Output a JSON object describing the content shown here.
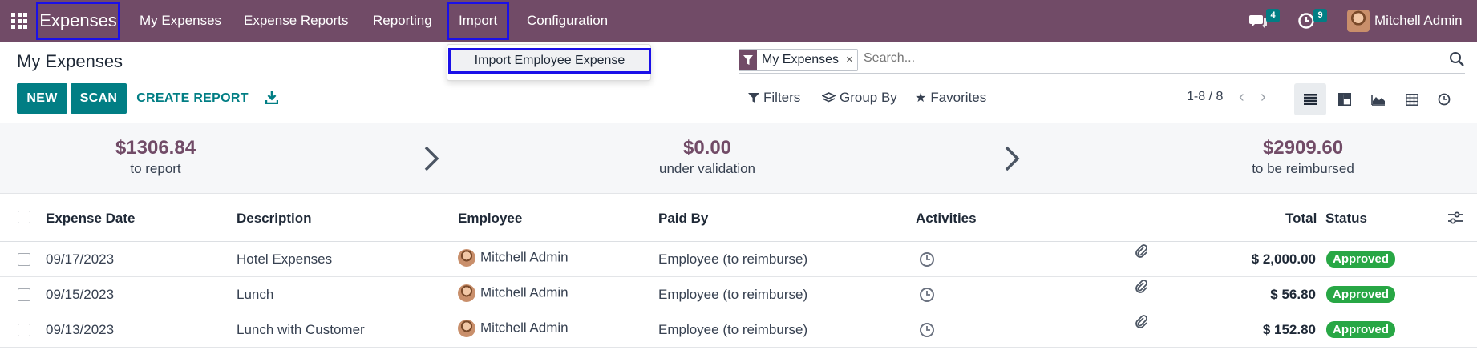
{
  "navbar": {
    "brand": "Expenses",
    "menu": [
      "My Expenses",
      "Expense Reports",
      "Reporting",
      "Import",
      "Configuration"
    ],
    "messages_count": "4",
    "activities_count": "9",
    "user_name": "Mitchell Admin"
  },
  "dropdown": {
    "item": "Import Employee Expense"
  },
  "control": {
    "title": "My Expenses",
    "new_label": "NEW",
    "scan_label": "SCAN",
    "create_report_label": "CREATE REPORT",
    "facet_label": "My Expenses",
    "facet_close": "×",
    "search_placeholder": "Search...",
    "filters_label": "Filters",
    "groupby_label": "Group By",
    "favorites_label": "Favorites",
    "pager": "1-8 / 8",
    "pager_prev": "‹",
    "pager_next": "›"
  },
  "stats": [
    {
      "amount": "$1306.84",
      "label": "to report"
    },
    {
      "amount": "$0.00",
      "label": "under validation"
    },
    {
      "amount": "$2909.60",
      "label": "to be reimbursed"
    }
  ],
  "table": {
    "headers": {
      "date": "Expense Date",
      "description": "Description",
      "employee": "Employee",
      "paid_by": "Paid By",
      "activities": "Activities",
      "total": "Total",
      "status": "Status"
    },
    "rows": [
      {
        "date": "09/17/2023",
        "description": "Hotel Expenses",
        "employee": "Mitchell Admin",
        "paid_by": "Employee (to reimburse)",
        "total": "$ 2,000.00",
        "status": "Approved"
      },
      {
        "date": "09/15/2023",
        "description": "Lunch",
        "employee": "Mitchell Admin",
        "paid_by": "Employee (to reimburse)",
        "total": "$ 56.80",
        "status": "Approved"
      },
      {
        "date": "09/13/2023",
        "description": "Lunch with Customer",
        "employee": "Mitchell Admin",
        "paid_by": "Employee (to reimburse)",
        "total": "$ 152.80",
        "status": "Approved"
      }
    ]
  },
  "colors": {
    "navbar": "#714b67",
    "primary": "#017e84",
    "approved": "#28a745",
    "highlight_border": "#1b10e8"
  }
}
